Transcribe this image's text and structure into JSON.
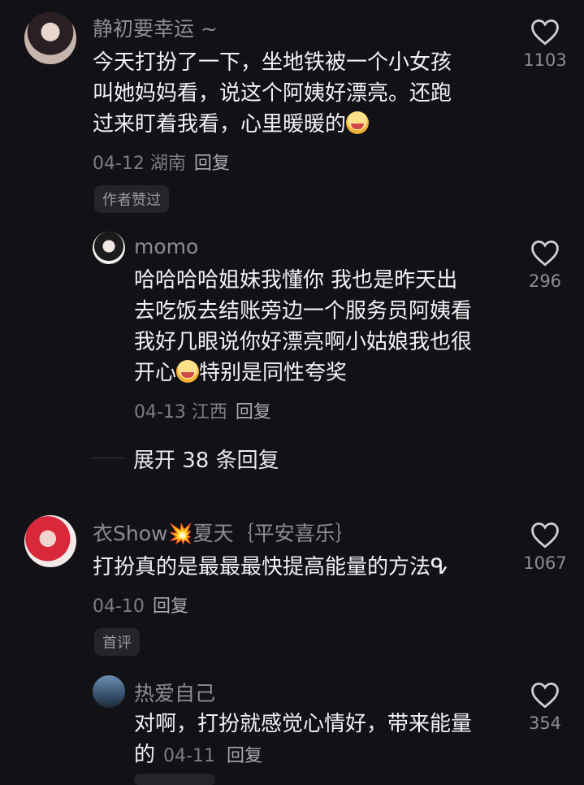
{
  "comments": [
    {
      "username": "静初要幸运 ~",
      "text_lines": [
        "今天打扮了一下，坐地铁被一个小女孩",
        "叫她妈妈看，说这个阿姨好漂亮。还跑",
        "过来盯着我看，心里暖暖的"
      ],
      "date_location": "04-12 湖南",
      "reply_label": "回复",
      "tag": "作者赞过",
      "likes": "1103",
      "replies": [
        {
          "username": "momo",
          "text_lines": [
            "哈哈哈哈姐妹我懂你 我也是昨天出",
            "去吃饭去结账旁边一个服务员阿姨看",
            "我好几眼说你好漂亮啊小姑娘我也很",
            "开心",
            "特别是同性夸奖"
          ],
          "date_location": "04-13 江西",
          "reply_label": "回复",
          "likes": "296"
        }
      ],
      "expand_label": "展开 38 条回复"
    },
    {
      "username": "衣Show💥夏天｛平安喜乐｝",
      "text_lines": [
        "打扮真的是最最最快提高能量的方法ᕴ"
      ],
      "date_location": "04-10",
      "reply_label": "回复",
      "tag": "首评",
      "likes": "1067",
      "replies": [
        {
          "username": "热爱自己",
          "text_lines": [
            "对啊，打扮就感觉心情好，带来能量",
            "的"
          ],
          "date_location": "04-11",
          "reply_label": "回复",
          "likes": "354"
        }
      ]
    }
  ],
  "icons": {
    "like": "heart-outline-icon",
    "emoji": "crying-laugh-emoji-icon"
  }
}
